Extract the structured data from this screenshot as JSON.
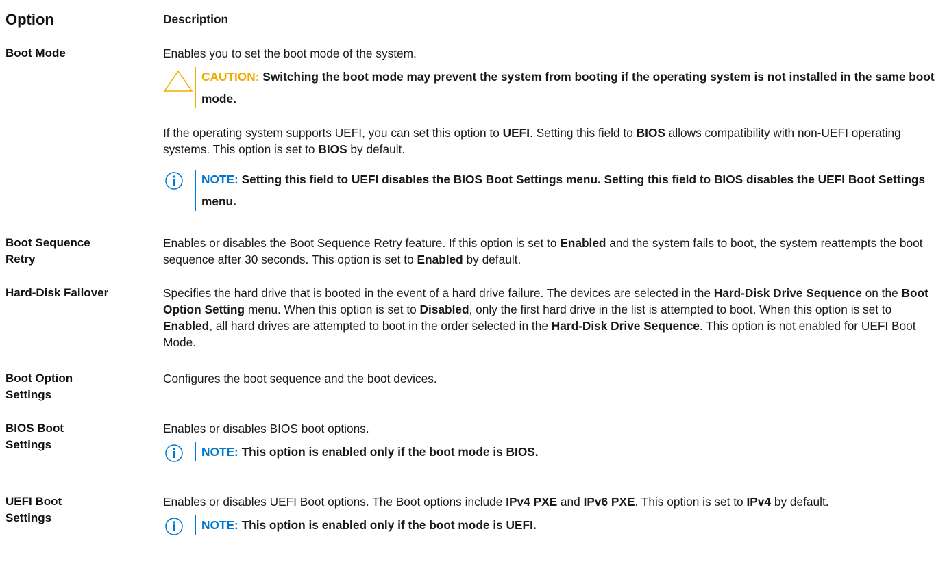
{
  "header": {
    "option": "Option",
    "description": "Description"
  },
  "rows": {
    "boot_mode": {
      "label": "Boot Mode",
      "intro": "Enables you to set the boot mode of the system.",
      "caution_kw": "CAUTION:",
      "caution_text": "Switching the boot mode may prevent the system from booting if the operating system is not installed in the same boot mode.",
      "p1_a": "If the operating system supports UEFI, you can set this option to ",
      "p1_b": "UEFI",
      "p1_c": ". Setting this field to ",
      "p1_d": "BIOS",
      "p1_e": " allows compatibility with non-UEFI operating systems. This option is set to ",
      "p1_f": "BIOS",
      "p1_g": " by default.",
      "note_kw": "NOTE:",
      "note_text": "Setting this field to UEFI disables the BIOS Boot Settings menu. Setting this field to BIOS disables the UEFI Boot Settings menu."
    },
    "boot_seq_retry": {
      "label": "Boot Sequence Retry",
      "a": "Enables or disables the Boot Sequence Retry feature. If this option is set to ",
      "b": "Enabled",
      "c": " and the system fails to boot, the system reattempts the boot sequence after 30 seconds. This option is set to ",
      "d": "Enabled",
      "e": " by default."
    },
    "hdd_failover": {
      "label": "Hard-Disk Failover",
      "a": "Specifies the hard drive that is booted in the event of a hard drive failure. The devices are selected in the ",
      "b": "Hard-Disk Drive Sequence",
      "c": " on the ",
      "d": "Boot Option Setting",
      "e": " menu. When this option is set to ",
      "f": "Disabled",
      "g": ", only the first hard drive in the list is attempted to boot. When this option is set to ",
      "h": "Enabled",
      "i": ", all hard drives are attempted to boot in the order selected in the ",
      "j": "Hard-Disk Drive Sequence",
      "k": ". This option is not enabled for UEFI Boot Mode."
    },
    "boot_option_settings": {
      "label": "Boot Option Settings",
      "text": "Configures the boot sequence and the boot devices."
    },
    "bios_boot_settings": {
      "label": "BIOS Boot Settings",
      "text": "Enables or disables BIOS boot options.",
      "note_kw": "NOTE:",
      "note_text": "This option is enabled only if the boot mode is BIOS."
    },
    "uefi_boot_settings": {
      "label": "UEFI Boot Settings",
      "a": "Enables or disables UEFI Boot options. The Boot options include ",
      "b": "IPv4 PXE",
      "c": " and ",
      "d": "IPv6 PXE",
      "e": ". This option is set to ",
      "f": "IPv4",
      "g": " by default.",
      "note_kw": "NOTE:",
      "note_text": "This option is enabled only if the boot mode is UEFI."
    }
  },
  "colors": {
    "caution": "#f0ab00",
    "note": "#0076ce"
  }
}
